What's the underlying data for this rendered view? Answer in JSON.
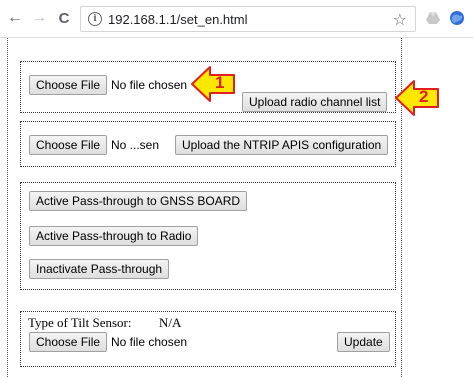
{
  "browser": {
    "url": "192.168.1.1/set_en.html",
    "back_glyph": "←",
    "forward_glyph": "→",
    "reload_glyph": "C",
    "info_glyph": "i",
    "star_glyph": "☆"
  },
  "section_radio": {
    "choose_label": "Choose File",
    "file_status": "No file chosen",
    "upload_label": "Upload radio channel list"
  },
  "section_ntrip": {
    "choose_label": "Choose File",
    "file_status": "No ...sen",
    "upload_label": "Upload the NTRIP APIS configuration"
  },
  "section_passthrough": {
    "gnss_label": "Active Pass-through to GNSS BOARD",
    "radio_label": "Active Pass-through to Radio",
    "inactivate_label": "Inactivate Pass-through"
  },
  "section_tilt": {
    "type_label": "Type of Tilt Sensor:",
    "type_value": "N/A",
    "choose_label": "Choose File",
    "file_status": "No file chosen",
    "update_label": "Update"
  },
  "callouts": [
    {
      "number": "1"
    },
    {
      "number": "2"
    }
  ],
  "colors": {
    "callout_fill": "#ffe800",
    "callout_stroke": "#e02020"
  }
}
